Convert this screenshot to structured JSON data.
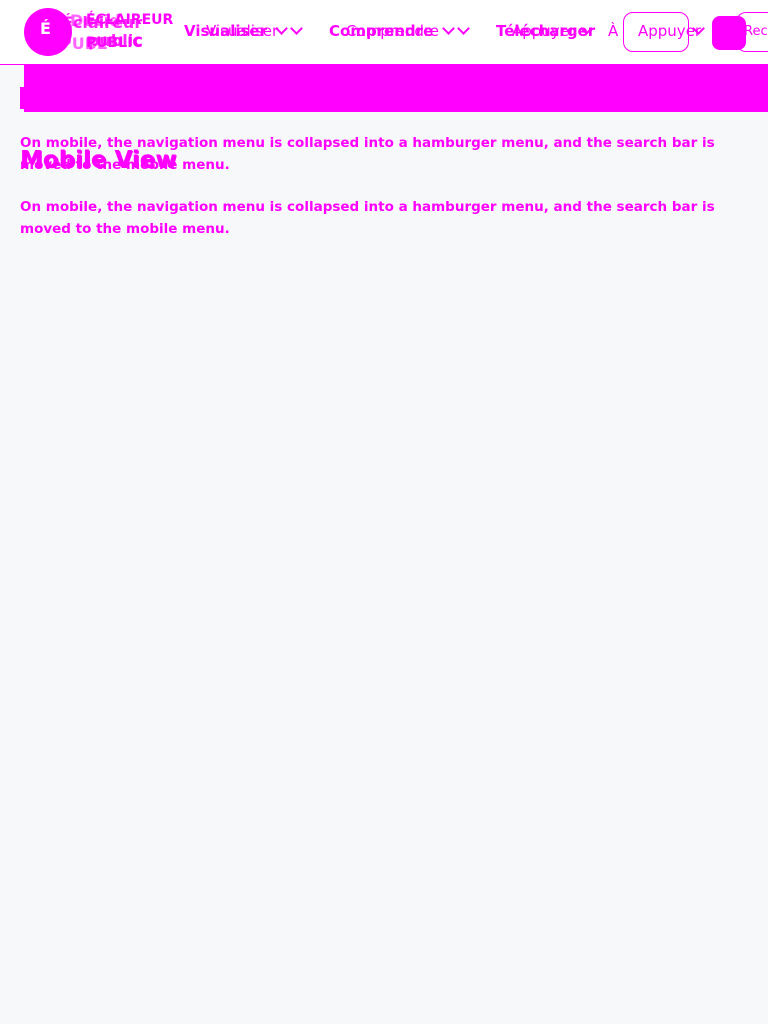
{
  "colors": {
    "accent": "#ff00ff",
    "page_background": "#f7f8fa",
    "header_background": "#ffffff"
  },
  "header": {
    "logo_mark": "É",
    "logo_lines": [
      "ÉCLAIREUR",
      "PUBLIC"
    ],
    "logo_lines_overlap": [
      "Éclaireur",
      "public"
    ],
    "logo_lines_overlap_2": [
      "Décid",
      "PUBL"
    ],
    "nav": [
      {
        "label": "Visualiser",
        "overlap": "Visualiser"
      },
      {
        "label": "Comprendre",
        "overlap": "Comprendre"
      },
      {
        "label": "Télécharger",
        "overlap": "Appuyer"
      },
      {
        "label": "À propos",
        "overlap": "Appuyer"
      }
    ],
    "search_label": "Rec",
    "search_overlap": "Rec"
  },
  "main": {
    "body_text": "On mobile, the navigation menu is collapsed into a hamburger menu, and the search bar is moved to the mobile menu.",
    "section_title": "Mobile View",
    "section_title_overlap": "Mobile View"
  }
}
